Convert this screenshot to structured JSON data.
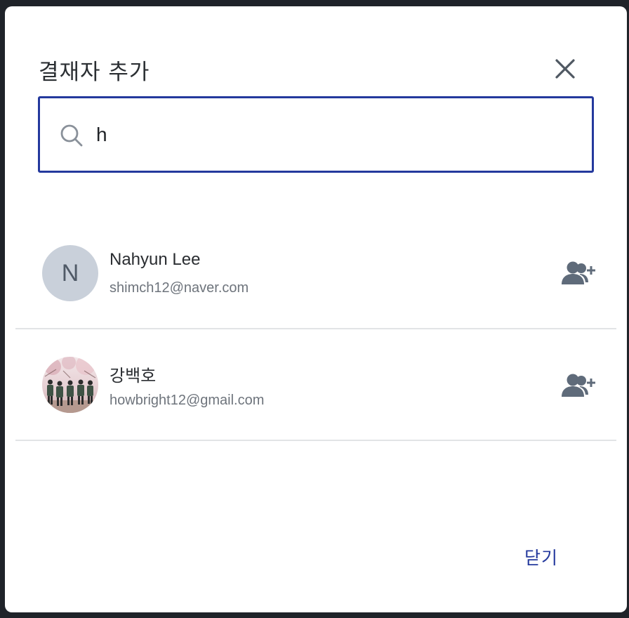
{
  "dialog": {
    "title": "결재자 추가",
    "close_icon": "close-icon",
    "close_button_label": "닫기"
  },
  "search": {
    "value": "h",
    "icon": "search-icon"
  },
  "results": [
    {
      "name": "Nahyun Lee",
      "email": "shimch12@naver.com",
      "avatar_letter": "N",
      "avatar_type": "letter",
      "action_icon": "add-user-icon"
    },
    {
      "name": "강백호",
      "email": "howbright12@gmail.com",
      "avatar_type": "photo",
      "action_icon": "add-user-icon"
    }
  ],
  "colors": {
    "accent": "#24399d",
    "avatar_bg": "#c9d0da",
    "icon_gray": "#5f6b7a"
  }
}
